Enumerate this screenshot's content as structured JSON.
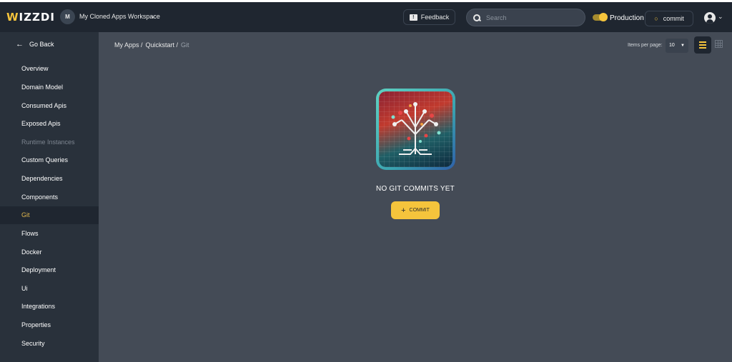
{
  "header": {
    "logo_lead": "W",
    "logo_rest": "IZZDI",
    "workspace_initial": "M",
    "workspace_name": "My Cloned Apps Workspace",
    "feedback_label": "Feedback",
    "search_placeholder": "Search",
    "environment_label": "Production",
    "environment_enabled": true,
    "commit_label": "commit"
  },
  "sidebar": {
    "go_back_label": "Go Back",
    "items": [
      {
        "label": "Overview",
        "state": "normal"
      },
      {
        "label": "Domain Model",
        "state": "normal"
      },
      {
        "label": "Consumed Apis",
        "state": "normal"
      },
      {
        "label": "Exposed Apis",
        "state": "normal"
      },
      {
        "label": "Runtime Instances",
        "state": "disabled"
      },
      {
        "label": "Custom Queries",
        "state": "normal"
      },
      {
        "label": "Dependencies",
        "state": "normal"
      },
      {
        "label": "Components",
        "state": "normal"
      },
      {
        "label": "Git",
        "state": "active"
      },
      {
        "label": "Flows",
        "state": "normal"
      },
      {
        "label": "Docker",
        "state": "normal"
      },
      {
        "label": "Deployment",
        "state": "normal"
      },
      {
        "label": "Ui",
        "state": "normal"
      },
      {
        "label": "Integrations",
        "state": "normal"
      },
      {
        "label": "Properties",
        "state": "normal"
      },
      {
        "label": "Security",
        "state": "normal"
      }
    ]
  },
  "main": {
    "breadcrumb": [
      {
        "label": "My Apps /"
      },
      {
        "label": "Quickstart /"
      },
      {
        "label": "Git"
      }
    ],
    "items_per_page_label": "Items per page:",
    "items_per_page_value": "10",
    "view_mode": "list",
    "empty_state": {
      "image": "git-tree-illustration",
      "title": "NO GIT COMMITS YET",
      "button_label": "COMMIT"
    }
  },
  "colors": {
    "accent": "#f5c43c",
    "topbar": "#1f2630",
    "sidebar": "#29313b",
    "main": "#444b56",
    "active_nav_text": "#e2b84e"
  }
}
